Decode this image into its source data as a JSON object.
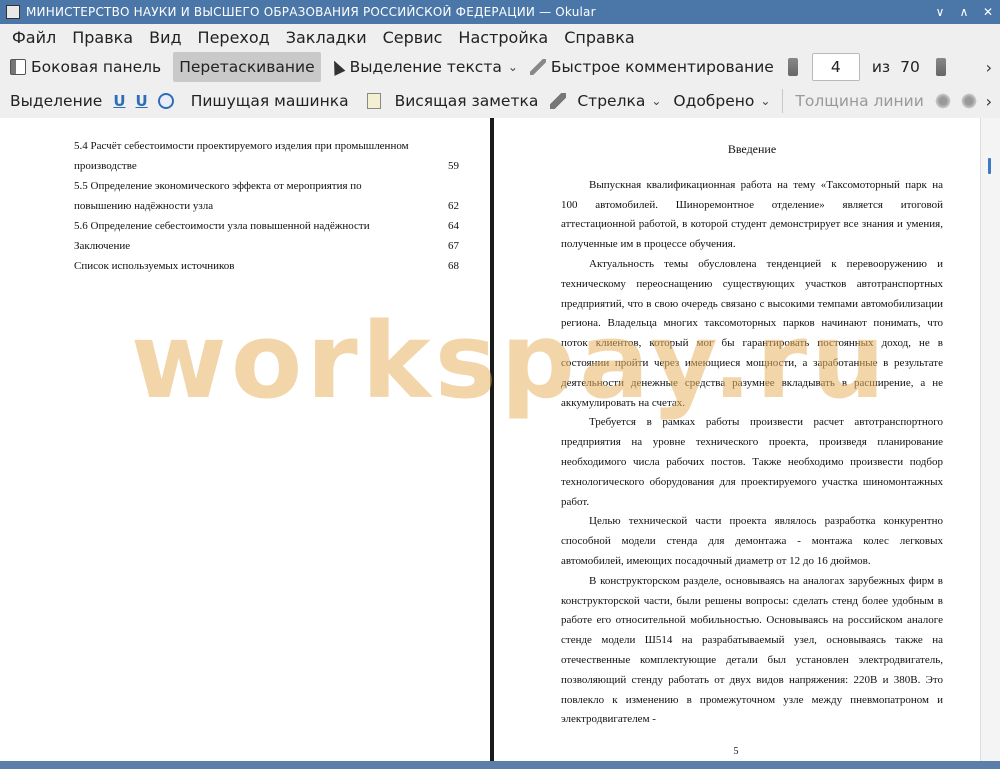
{
  "window": {
    "title": "МИНИСТЕРСТВО НАУКИ И ВЫСШЕГО ОБРАЗОВАНИЯ РОССИЙСКОЙ ФЕДЕРАЦИИ  — Okular",
    "controls": [
      "∨",
      "∧",
      "✕"
    ]
  },
  "menu": [
    "Файл",
    "Правка",
    "Вид",
    "Переход",
    "Закладки",
    "Сервис",
    "Настройка",
    "Справка"
  ],
  "toolbar1": {
    "sidebar": "Боковая панель",
    "drag": "Перетаскивание",
    "text_select": "Выделение текста",
    "quick_comment": "Быстрое комментирование",
    "page_current": "4",
    "page_of": "из",
    "page_total": "70",
    "more": "›"
  },
  "toolbar2": {
    "selection": "Выделение",
    "typewriter": "Пишущая машинка",
    "hanging_note": "Висящая заметка",
    "arrow": "Стрелка",
    "approved": "Одобрено",
    "line_width": "Толщина линии",
    "more": "›"
  },
  "left_page": {
    "toc": [
      {
        "text": "5.4 Расчёт себестоимости проектируемого изделия при промышленном",
        "page": ""
      },
      {
        "text": "производстве",
        "page": "59"
      },
      {
        "text": "5.5 Определение экономического эффекта от мероприятия по",
        "page": ""
      },
      {
        "text": "повышению надёжности узла",
        "page": "62"
      },
      {
        "text": "5.6 Определение себестоимости узла повышенной надёжности",
        "page": "64"
      },
      {
        "text": "Заключение",
        "page": "67"
      },
      {
        "text": "Список используемых источников",
        "page": "68"
      }
    ]
  },
  "right_page": {
    "heading": "Введение",
    "paragraphs": [
      "Выпускная квалификационная работа на тему «Таксомоторный парк на 100 автомобилей. Шиноремонтное отделение» является итоговой аттестационной работой, в которой студент демонстрирует все знания и умения, полученные им в процессе обучения.",
      "Актуальность темы обусловлена тенденцией к перевооружению и техническому переоснащению существующих участков автотранспортных предприятий, что в свою очередь связано с высокими темпами автомобилизации региона. Владельца многих таксомоторных парков начинают понимать, что поток клиентов, который мог бы гарантировать постоянных доход, не в состоянии пройти через имеющиеся мощности, а заработанные в результате деятельности денежные средства разумнее вкладывать в расширение, а не аккумулировать на счетах.",
      "Требуется в рамках работы произвести расчет автотранспортного предприятия на уровне технического проекта, произведя планирование необходимого числа рабочих постов. Также необходимо произвести подбор технологического оборудования для проектируемого участка шиномонтажных работ.",
      "Целью технической части проекта являлось разработка конкурентно способной модели стенда для демонтажа - монтажа колес легковых автомобилей, имеющих посадочный диаметр от 12 до 16 дюймов.",
      "В конструкторском разделе, основываясь на аналогах зарубежных фирм в конструкторской части, были решены вопросы: сделать стенд более удобным в работе его относительной мобильностью. Основываясь на российском аналоге стенде модели Ш514 на разрабатываемый узел, основываясь также на отечественные комплектующие детали был установлен электродвигатель, позволяющий стенду работать от двух видов напряжения: 220В и 380В. Это повлекло к изменению в промежуточном узле между пневмопатроном и электродвигателем -"
    ],
    "page_number": "5"
  },
  "watermark": "workspay.ru"
}
